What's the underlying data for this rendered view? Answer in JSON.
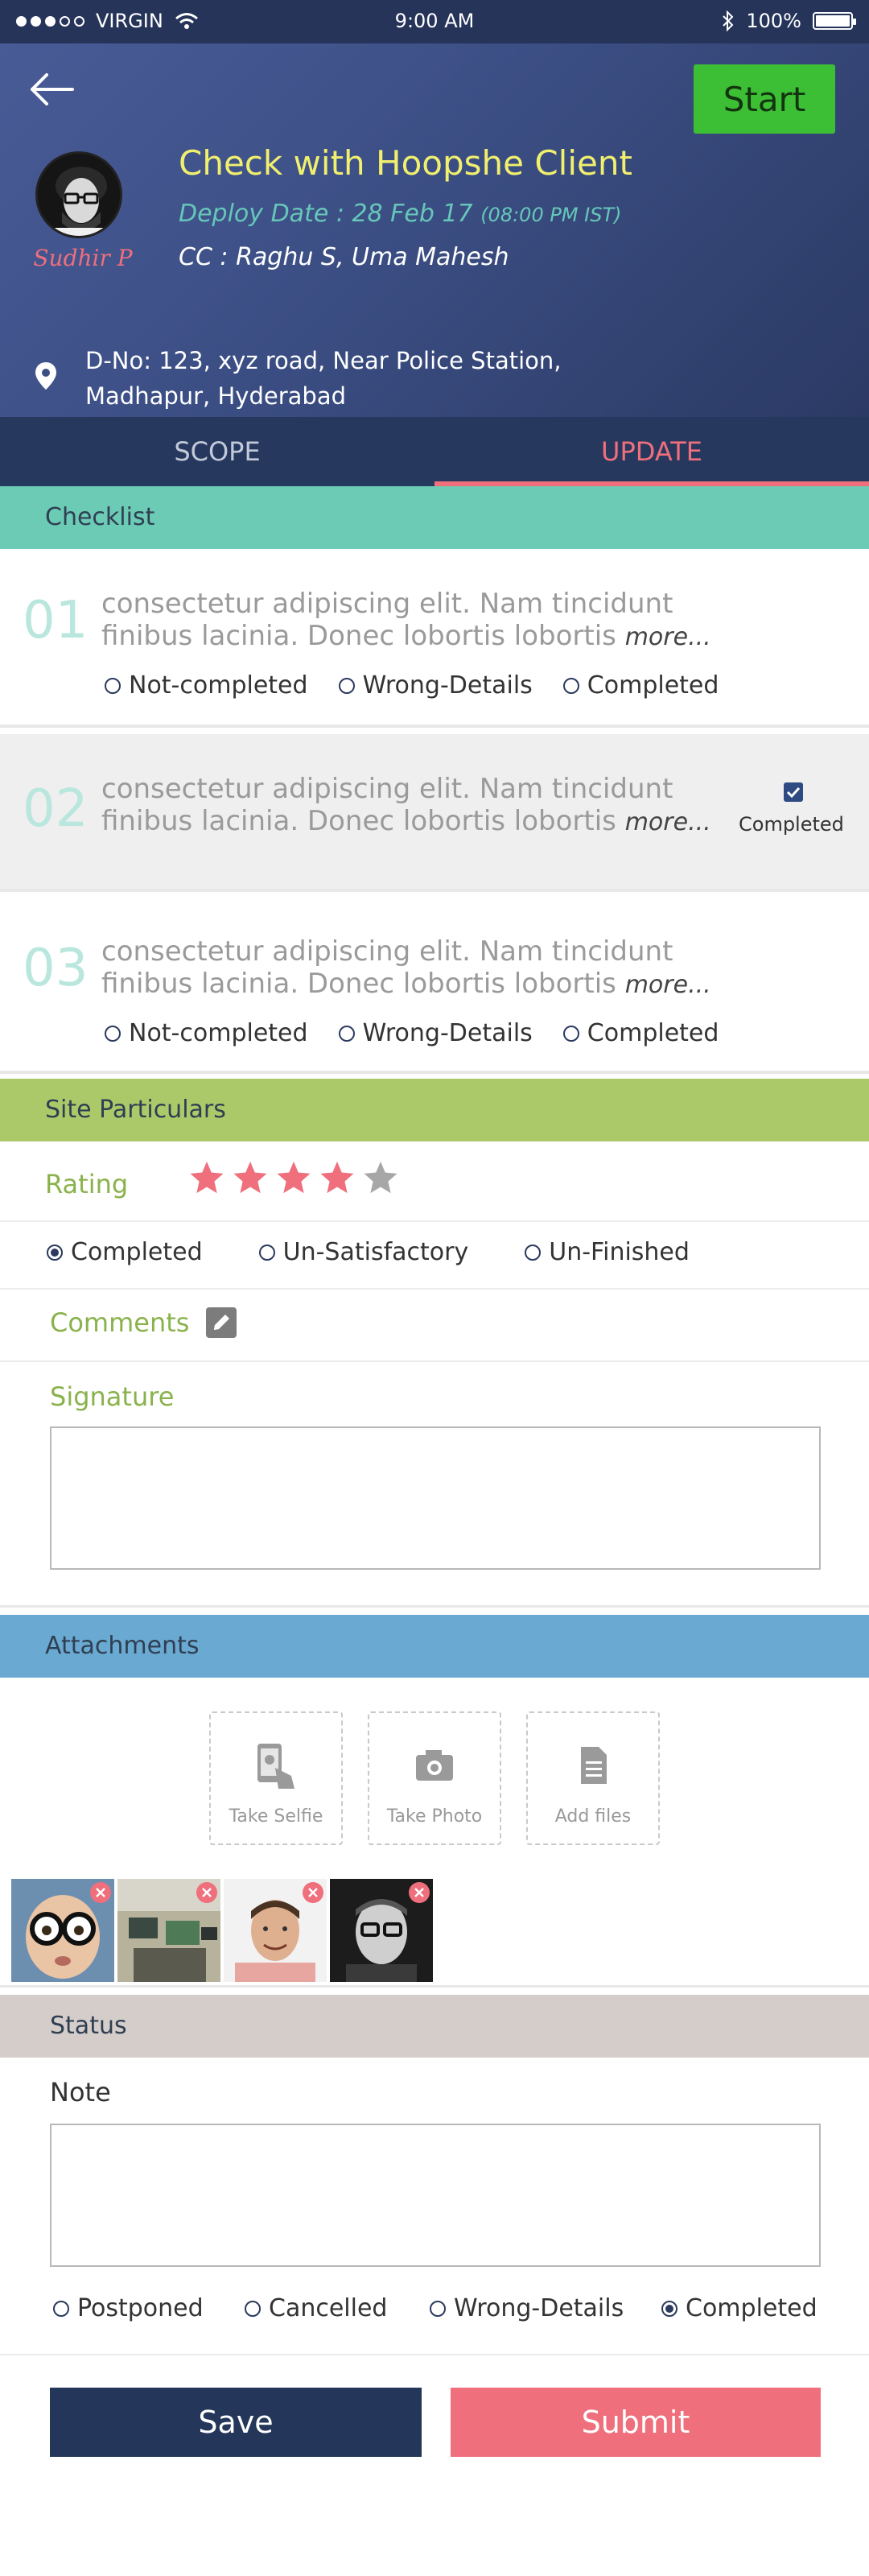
{
  "status_bar": {
    "carrier": "VIRGIN",
    "time": "9:00 AM",
    "battery": "100%"
  },
  "header": {
    "start_label": "Start",
    "avatar_name": "Sudhir P",
    "title": "Check with Hoopshe Client",
    "deploy_prefix": "Deploy Date : 28 Feb 17",
    "deploy_time": "(08:00 PM IST)",
    "cc": "CC : Raghu S, Uma Mahesh",
    "address_line1": "D-No: 123, xyz road, Near Police Station,",
    "address_line2": "Madhapur, Hyderabad",
    "icons": {
      "back": "arrow-left-icon",
      "location": "map-pin-icon"
    }
  },
  "tabs": [
    {
      "label": "SCOPE"
    },
    {
      "label": "UPDATE"
    }
  ],
  "checklist": {
    "header": "Checklist",
    "header_color": "#6ccbb5",
    "items": [
      {
        "num": "01",
        "line1": "consectetur adipiscing elit. Nam tincidunt",
        "line2": "finibus lacinia. Donec lobortis lobortis",
        "more": "more...",
        "options": [
          "Not-completed",
          "Wrong-Details",
          "Completed"
        ]
      },
      {
        "num": "02",
        "line1": "consectetur adipiscing elit. Nam tincidunt",
        "line2": "finibus lacinia. Donec lobortis lobortis",
        "more": "more...",
        "checked_label": "Completed"
      },
      {
        "num": "03",
        "line1": "consectetur adipiscing elit. Nam tincidunt",
        "line2": "finibus lacinia. Donec lobortis lobortis",
        "more": "more...",
        "options": [
          "Not-completed",
          "Wrong-Details",
          "Completed"
        ]
      }
    ]
  },
  "site": {
    "header": "Site Particulars",
    "header_color": "#acc96a",
    "rating_label": "Rating",
    "rating": 4,
    "rating_max": 5,
    "options": [
      "Completed",
      "Un-Satisfactory",
      "Un-Finished"
    ],
    "selected": "Completed",
    "comments_label": "Comments",
    "signature_label": "Signature"
  },
  "attachments": {
    "header": "Attachments",
    "header_color": "#6aa9d2",
    "actions": [
      {
        "label": "Take Selfie",
        "icon": "selfie-icon"
      },
      {
        "label": "Take Photo",
        "icon": "camera-icon"
      },
      {
        "label": "Add files",
        "icon": "file-icon"
      }
    ],
    "thumbnails": [
      "child-with-glasses",
      "office-computers",
      "smiling-man",
      "man-with-glasses"
    ]
  },
  "status": {
    "header": "Status",
    "header_color": "#d5cdca",
    "note_label": "Note",
    "options": [
      "Postponed",
      "Cancelled",
      "Wrong-Details",
      "Completed"
    ],
    "selected": "Completed"
  },
  "actions": {
    "save": "Save",
    "submit": "Submit"
  }
}
